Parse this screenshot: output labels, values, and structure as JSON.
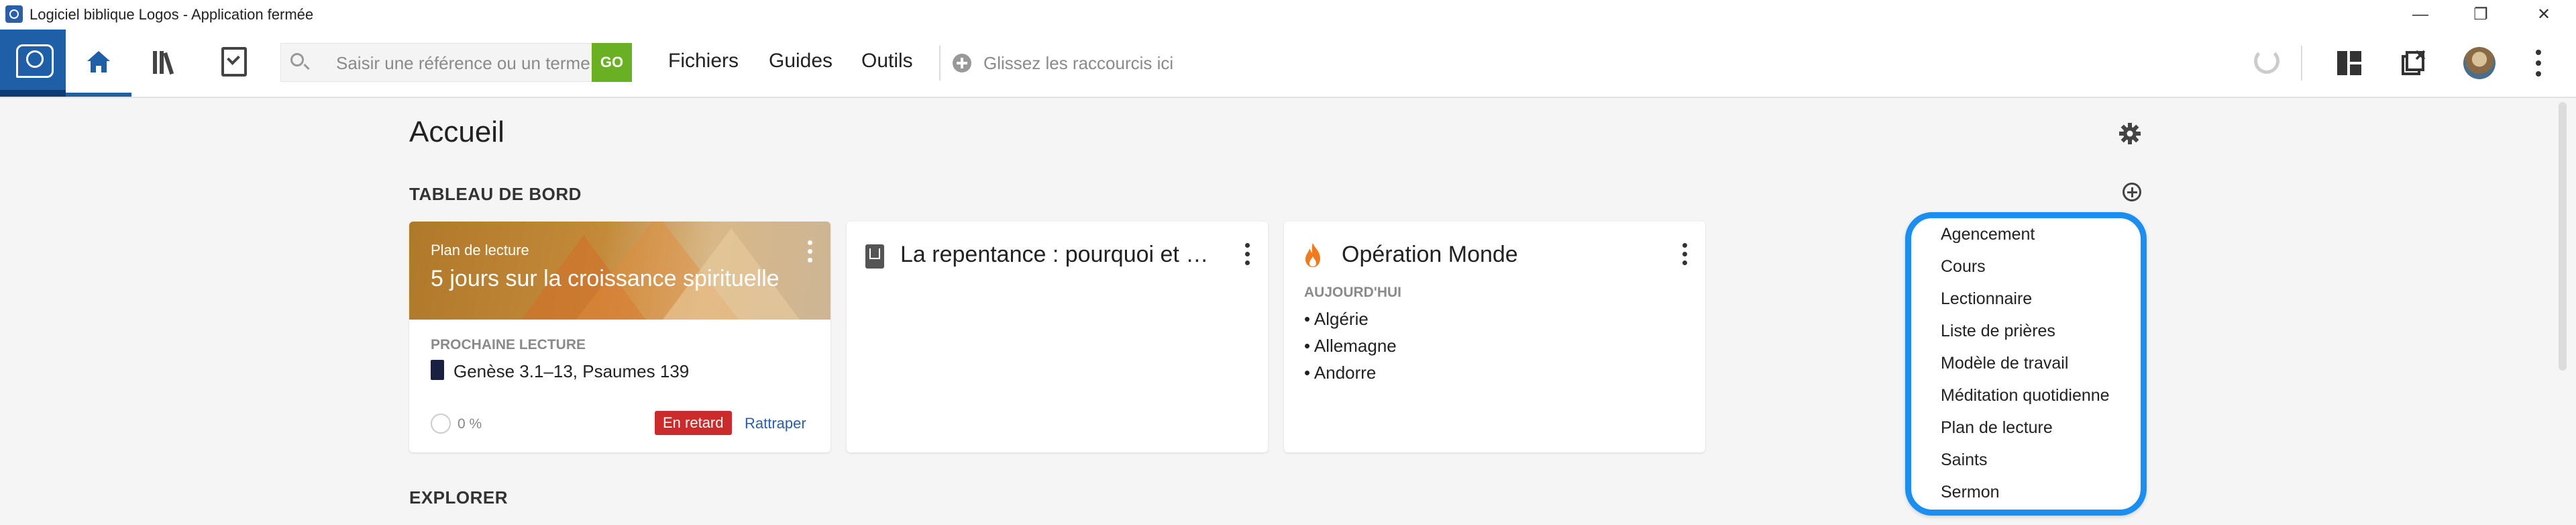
{
  "window": {
    "title": "Logiciel biblique Logos - Application fermée",
    "minimize_icon": "minimize-icon",
    "restore_icon": "restore-icon",
    "close_icon": "close-icon"
  },
  "toolbar": {
    "search": {
      "placeholder": "Saisir une référence ou un terme",
      "go_label": "GO"
    },
    "menus": [
      "Fichiers",
      "Guides",
      "Outils"
    ],
    "shortcuts_placeholder": "Glissez les raccourcis ici",
    "icons": {
      "logo": "logos-logo-icon",
      "home": "home-icon",
      "library": "library-icon",
      "tasks": "tasks-icon",
      "sync": "sync-icon",
      "layout": "layout-icon",
      "close_panels": "close-panels-icon",
      "more": "more-vertical-icon"
    }
  },
  "main": {
    "page_title": "Accueil",
    "dashboard_label": "TABLEAU DE BORD",
    "explore_label": "EXPLORER",
    "cards": {
      "reading_plan": {
        "small_label": "Plan de lecture",
        "title": "5 jours sur la croissance spirituelle",
        "next_label": "PROCHAINE LECTURE",
        "next_reading": "Genèse 3.1–13, Psaumes 139",
        "progress": "0 %",
        "late_badge": "En retard",
        "catch_up": "Rattraper"
      },
      "document": {
        "title": "La repentance : pourquoi et …"
      },
      "operation": {
        "title": "Opération Monde",
        "today_label": "AUJOURD'HUI",
        "items": [
          "• Algérie",
          "• Allemagne",
          "• Andorre"
        ]
      }
    },
    "add_widget_menu": {
      "items": [
        "Agencement",
        "Cours",
        "Lectionnaire",
        "Liste de prières",
        "Modèle de travail",
        "Méditation quotidienne",
        "Plan de lecture",
        "Saints",
        "Sermon"
      ]
    }
  },
  "colors": {
    "accent": "#1f5fa8",
    "go": "#6ab023",
    "late": "#cc2b2b",
    "highlight": "#1b8ef2",
    "flame": "#f07a1e"
  }
}
